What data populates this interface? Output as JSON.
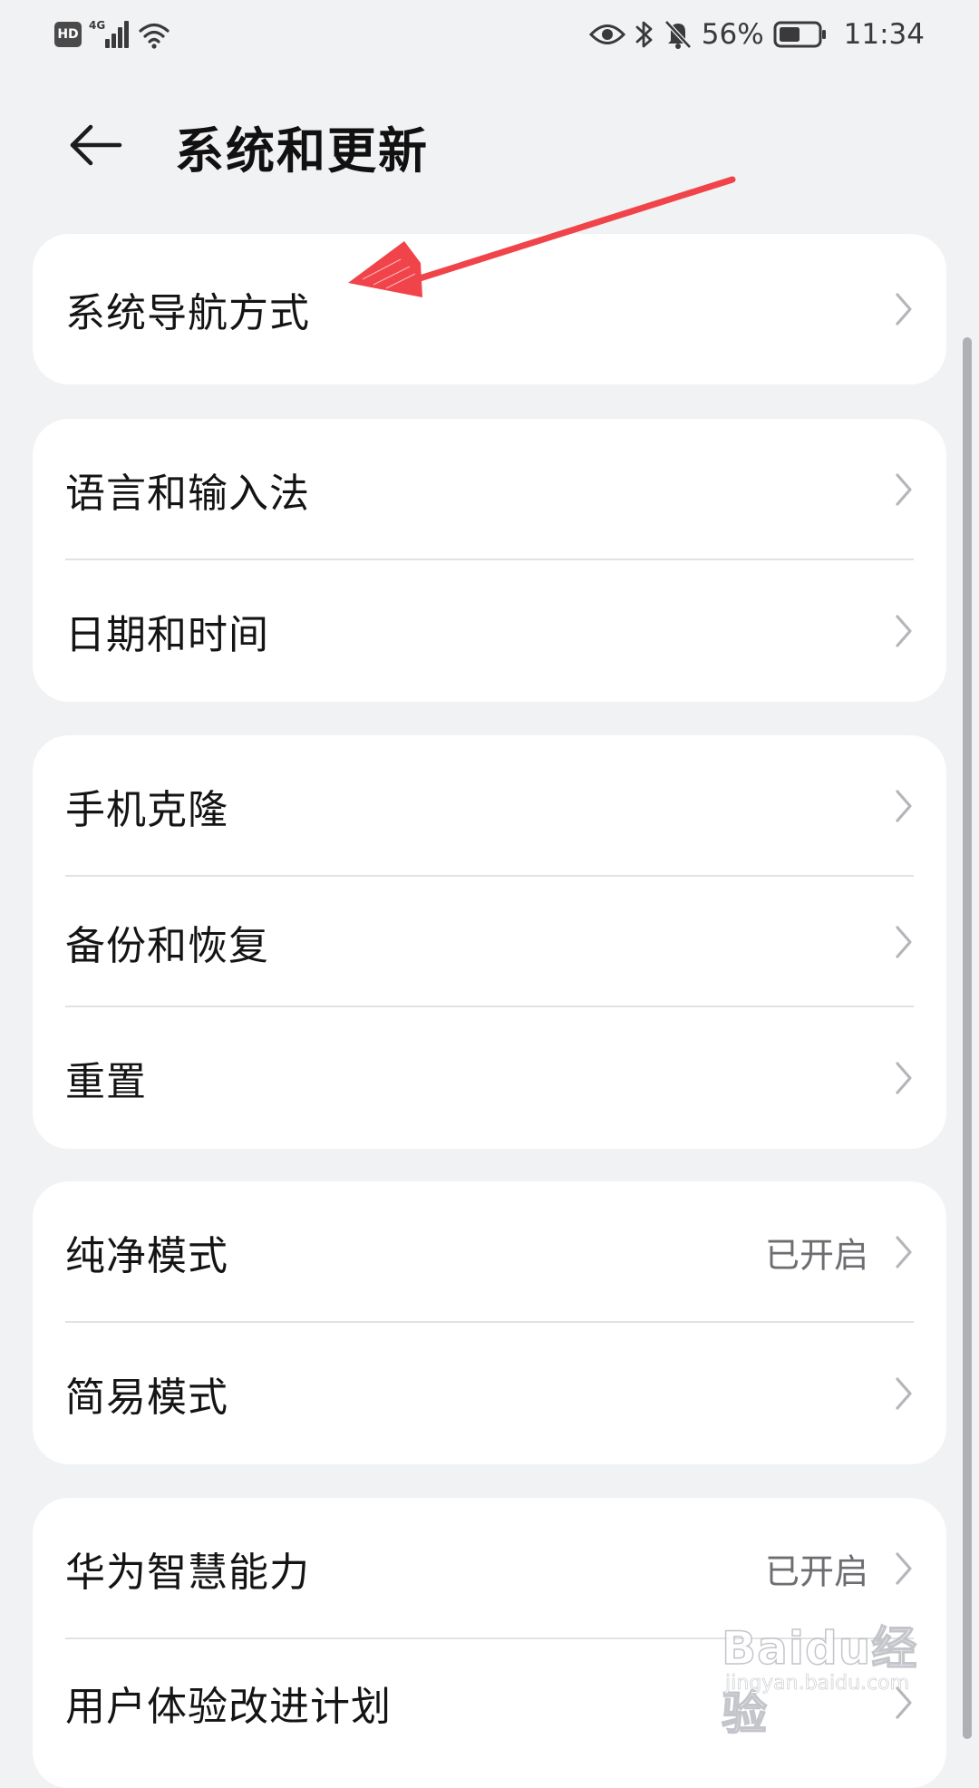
{
  "status_bar": {
    "hd_badge": "HD",
    "network": "4G",
    "battery_percent": "56%",
    "battery_level": 0.56,
    "time": "11:34",
    "icons": [
      "hd-badge",
      "signal-icon",
      "wifi-icon",
      "eye-icon",
      "bluetooth-icon",
      "bell-off-icon",
      "battery-icon"
    ]
  },
  "header": {
    "back_icon": "arrow-left-icon",
    "title": "系统和更新"
  },
  "groups": [
    {
      "items": [
        {
          "label": "系统导航方式"
        }
      ]
    },
    {
      "items": [
        {
          "label": "语言和输入法"
        },
        {
          "label": "日期和时间"
        }
      ]
    },
    {
      "items": [
        {
          "label": "手机克隆"
        },
        {
          "label": "备份和恢复"
        },
        {
          "label": "重置"
        }
      ]
    },
    {
      "items": [
        {
          "label": "纯净模式",
          "value": "已开启"
        },
        {
          "label": "简易模式"
        }
      ]
    },
    {
      "items": [
        {
          "label": "华为智慧能力",
          "value": "已开启"
        },
        {
          "label": "用户体验改进计划"
        }
      ]
    }
  ],
  "annotation": {
    "color": "#F0434A"
  },
  "watermark": {
    "brand": "Baidu经验",
    "url": "jingyan.baidu.com"
  },
  "colors": {
    "background": "#F1F2F4",
    "card": "#FFFFFF",
    "text_primary": "#141414",
    "text_secondary": "#6D6D72",
    "chevron": "#B5B5BA"
  }
}
